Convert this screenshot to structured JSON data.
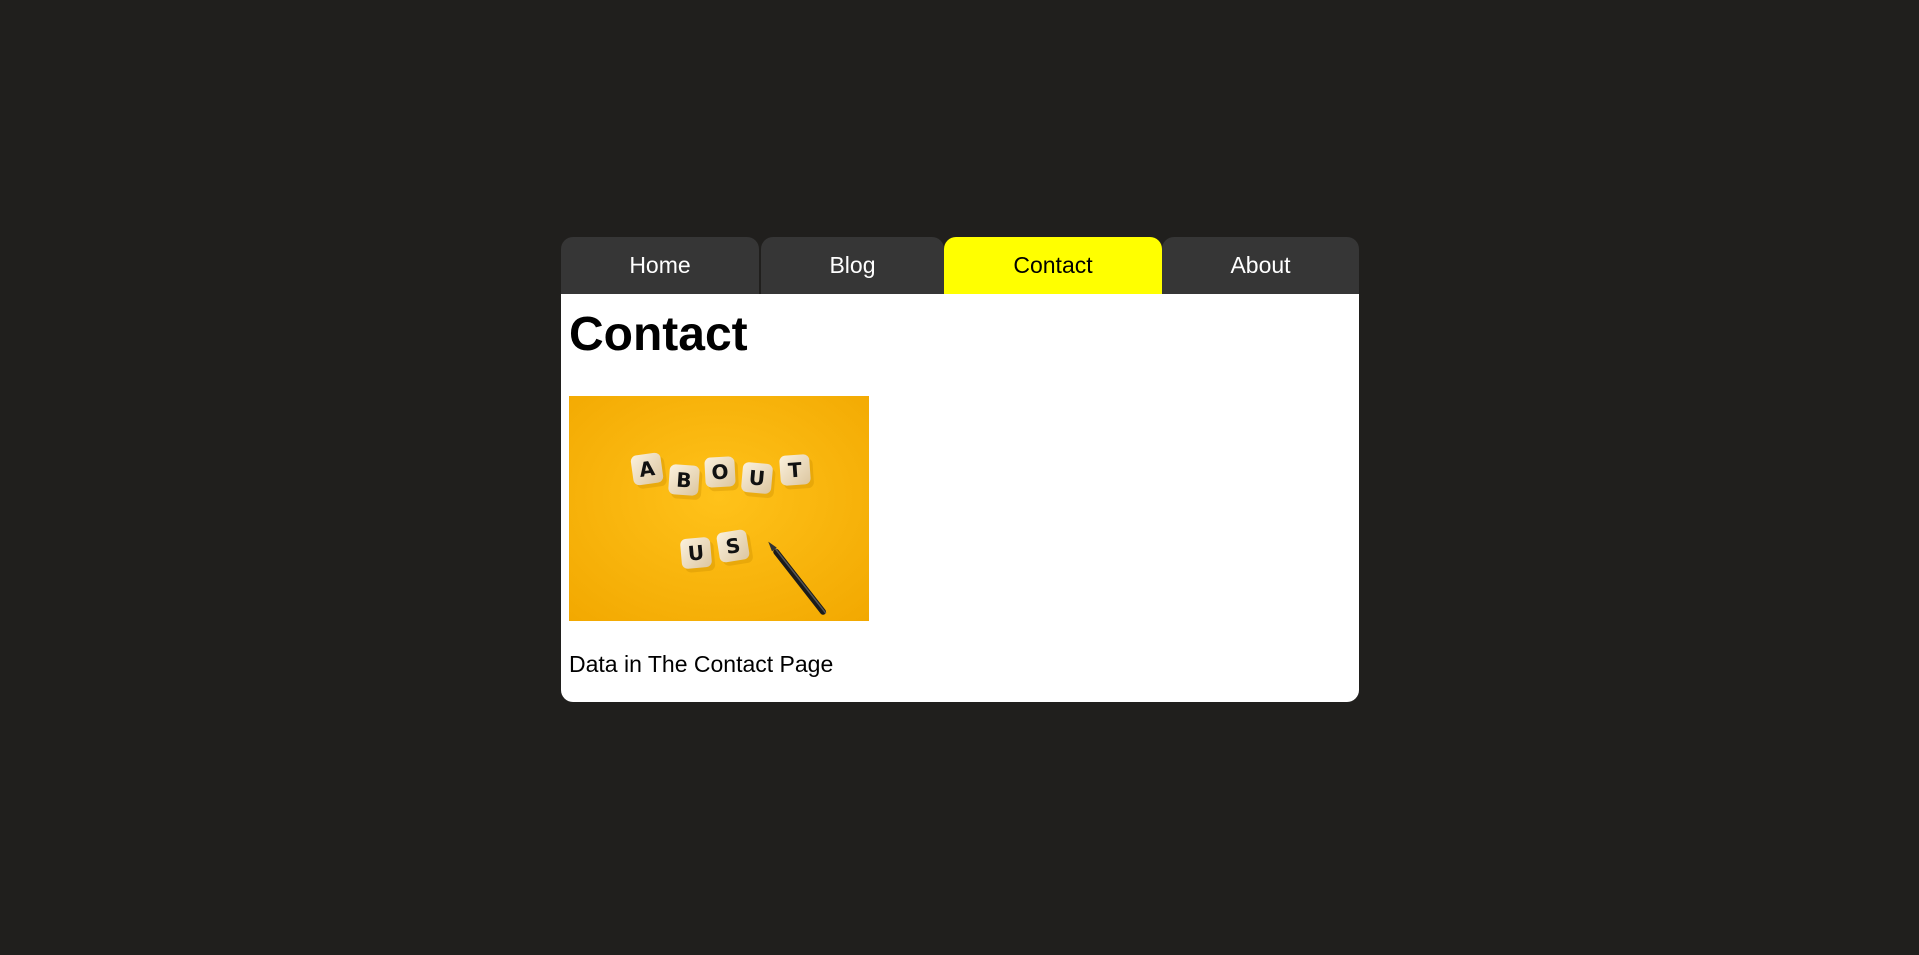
{
  "tabs": [
    {
      "label": "Home",
      "active": false
    },
    {
      "label": "Blog",
      "active": false
    },
    {
      "label": "Contact",
      "active": true
    },
    {
      "label": "About",
      "active": false
    }
  ],
  "panel": {
    "title": "Contact",
    "image_text_line1": [
      "A",
      "B",
      "O",
      "U",
      "T"
    ],
    "image_text_line2": [
      "U",
      "S"
    ],
    "text": "Data in The Contact Page"
  },
  "colors": {
    "page_background": "#201f1d",
    "tab_background": "#363636",
    "active_tab": "#ffff00",
    "panel_background": "#ffffff",
    "image_background": "#fbb400"
  }
}
